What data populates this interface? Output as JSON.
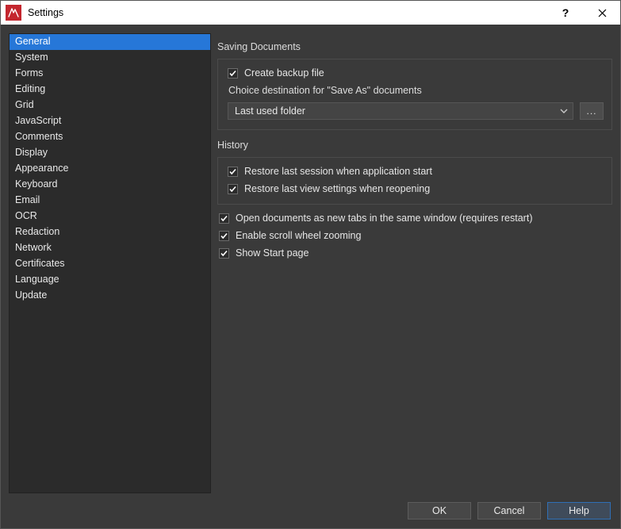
{
  "window": {
    "title": "Settings"
  },
  "sidebar": {
    "items": [
      "General",
      "System",
      "Forms",
      "Editing",
      "Grid",
      "JavaScript",
      "Comments",
      "Display",
      "Appearance",
      "Keyboard",
      "Email",
      "OCR",
      "Redaction",
      "Network",
      "Certificates",
      "Language",
      "Update"
    ],
    "selected_index": 0
  },
  "content": {
    "group1": {
      "title": "Saving Documents",
      "create_backup": {
        "label": "Create backup file",
        "checked": true
      },
      "save_as_dest_label": "Choice destination for \"Save As\" documents",
      "save_as_combo": {
        "value": "Last used folder"
      },
      "browse_label": "..."
    },
    "group2": {
      "title": "History",
      "restore_session": {
        "label": "Restore last session when application start",
        "checked": true
      },
      "restore_view": {
        "label": "Restore last view settings when reopening",
        "checked": true
      }
    },
    "open_tabs": {
      "label": "Open documents as new tabs in the same window (requires restart)",
      "checked": true
    },
    "scroll_zoom": {
      "label": "Enable scroll wheel zooming",
      "checked": true
    },
    "start_page": {
      "label": "Show Start page",
      "checked": true
    }
  },
  "footer": {
    "ok": "OK",
    "cancel": "Cancel",
    "help": "Help"
  }
}
